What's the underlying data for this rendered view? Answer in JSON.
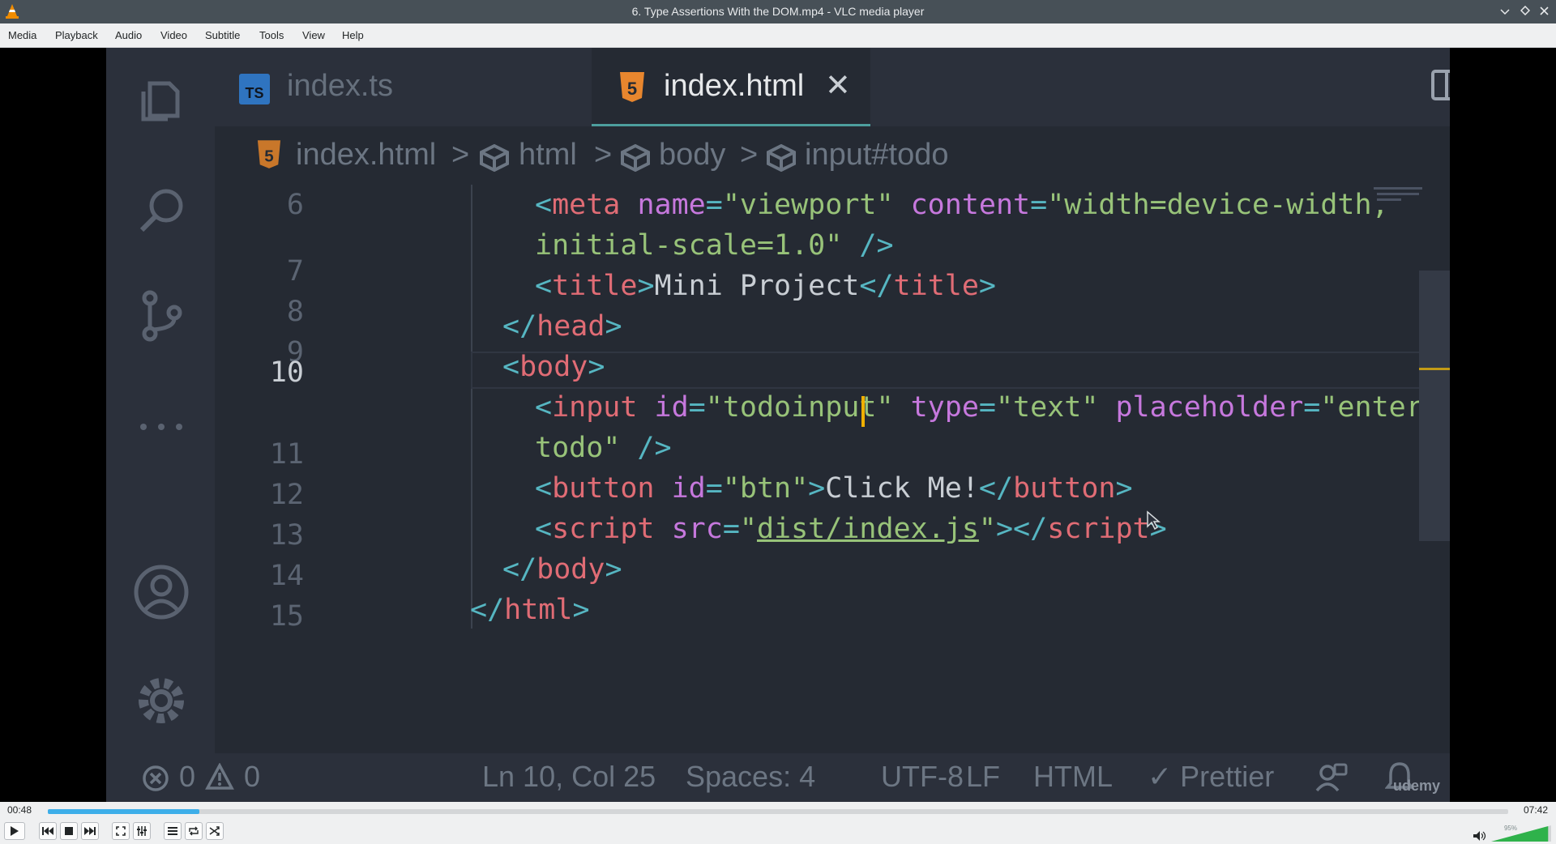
{
  "window": {
    "title": "6. Type Assertions With the DOM.mp4 - VLC media player"
  },
  "menu": [
    "Media",
    "Playback",
    "Audio",
    "Video",
    "Subtitle",
    "Tools",
    "View",
    "Help"
  ],
  "vscode": {
    "tabs": [
      {
        "badge": "TS",
        "label": "index.ts"
      },
      {
        "badge": "5",
        "label": "index.html",
        "close": "✕"
      }
    ],
    "breadcrumb": {
      "file": "index.html",
      "sep": ">",
      "items": [
        "html",
        "body",
        "input#todo"
      ]
    },
    "line_numbers": [
      "6",
      "7",
      "8",
      "9",
      "10",
      "11",
      "12",
      "13",
      "14",
      "15"
    ],
    "code_lines": [
      [
        [
          "<",
          "p"
        ],
        [
          "meta",
          "t"
        ],
        [
          " name",
          "a"
        ],
        [
          "=",
          "p"
        ],
        [
          "\"viewport\"",
          "s"
        ],
        [
          " content",
          "a"
        ],
        [
          "=",
          "p"
        ],
        [
          "\"width=device-width,",
          "s"
        ]
      ],
      [
        [
          "initial-scale=1.0\"",
          "s"
        ],
        [
          " />",
          "p"
        ]
      ],
      [
        [
          "<",
          "p"
        ],
        [
          "title",
          "t"
        ],
        [
          ">",
          "p"
        ],
        [
          "Mini Project",
          "x"
        ],
        [
          "</",
          "p"
        ],
        [
          "title",
          "t"
        ],
        [
          ">",
          "p"
        ]
      ],
      [
        [
          "</",
          "p"
        ],
        [
          "head",
          "t"
        ],
        [
          ">",
          "p"
        ]
      ],
      [
        [
          "<",
          "p"
        ],
        [
          "body",
          "t"
        ],
        [
          ">",
          "p"
        ]
      ],
      [
        [
          "<",
          "p"
        ],
        [
          "input",
          "t"
        ],
        [
          " id",
          "a"
        ],
        [
          "=",
          "p"
        ],
        [
          "\"todoinput\"",
          "s"
        ],
        [
          " type",
          "a"
        ],
        [
          "=",
          "p"
        ],
        [
          "\"text\"",
          "s"
        ],
        [
          " placeholder",
          "a"
        ],
        [
          "=",
          "p"
        ],
        [
          "\"enter a",
          "s"
        ]
      ],
      [
        [
          "todo\"",
          "s"
        ],
        [
          " />",
          "p"
        ]
      ],
      [
        [
          "<",
          "p"
        ],
        [
          "button",
          "t"
        ],
        [
          " id",
          "a"
        ],
        [
          "=",
          "p"
        ],
        [
          "\"btn\"",
          "s"
        ],
        [
          ">",
          "p"
        ],
        [
          "Click Me!",
          "x"
        ],
        [
          "</",
          "p"
        ],
        [
          "button",
          "t"
        ],
        [
          ">",
          "p"
        ]
      ],
      [
        [
          "<",
          "p"
        ],
        [
          "script",
          "t"
        ],
        [
          " src",
          "a"
        ],
        [
          "=",
          "p"
        ],
        [
          "\"",
          "s"
        ],
        [
          "dist/index.js",
          "u"
        ],
        [
          "\"",
          "s"
        ],
        [
          "></",
          "p"
        ],
        [
          "script",
          "t"
        ],
        [
          ">",
          "p"
        ]
      ],
      [
        [
          "</",
          "p"
        ],
        [
          "body",
          "t"
        ],
        [
          ">",
          "p"
        ]
      ],
      [
        [
          "</",
          "p"
        ],
        [
          "html",
          "t"
        ],
        [
          ">",
          "p"
        ]
      ]
    ],
    "status": {
      "errors": "0",
      "warnings": "0",
      "position": "Ln 10, Col 25",
      "spaces": "Spaces: 4",
      "encoding": "UTF-8",
      "eol": "LF",
      "language": "HTML",
      "formatter": "✓ Prettier",
      "watermark": "udemy"
    },
    "colors": {
      "tag": "#e06c75",
      "punct": "#56b6c2",
      "attr": "#c678dd",
      "string": "#98c379",
      "text": "#c9ced4",
      "caret": "#f0b000"
    }
  },
  "player": {
    "elapsed": "00:48",
    "total": "07:42",
    "progress": 0.104,
    "volume_label": "95%",
    "volume": 0.95
  }
}
